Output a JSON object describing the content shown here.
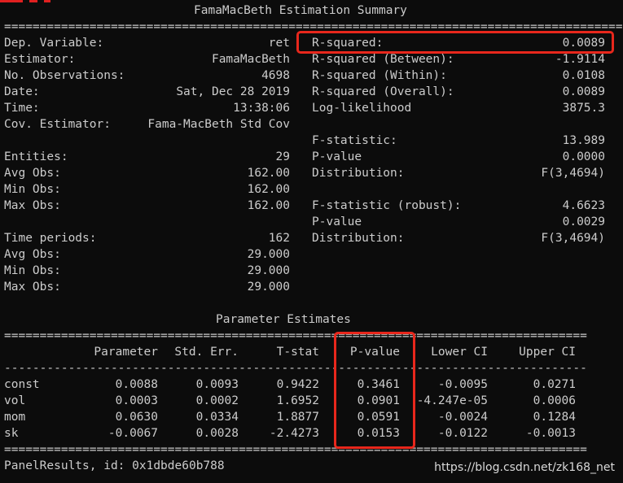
{
  "summary": {
    "title": "FamaMacBeth Estimation Summary",
    "rows": [
      {
        "left_label": "Dep. Variable:",
        "left_value": "ret",
        "right_label": "R-squared:",
        "right_value": "0.0089"
      },
      {
        "left_label": "Estimator:",
        "left_value": "FamaMacBeth",
        "right_label": "R-squared (Between):",
        "right_value": "-1.9114"
      },
      {
        "left_label": "No. Observations:",
        "left_value": "4698",
        "right_label": "R-squared (Within):",
        "right_value": "0.0108"
      },
      {
        "left_label": "Date:",
        "left_value": "Sat, Dec 28 2019",
        "right_label": "R-squared (Overall):",
        "right_value": "0.0089"
      },
      {
        "left_label": "Time:",
        "left_value": "13:38:06",
        "right_label": "Log-likelihood",
        "right_value": "3875.3"
      },
      {
        "left_label": "Cov. Estimator:",
        "left_value": "Fama-MacBeth Std Cov",
        "right_label": "",
        "right_value": ""
      },
      {
        "left_label": "",
        "left_value": "",
        "right_label": "F-statistic:",
        "right_value": "13.989"
      },
      {
        "left_label": "Entities:",
        "left_value": "29",
        "right_label": "P-value",
        "right_value": "0.0000"
      },
      {
        "left_label": "Avg Obs:",
        "left_value": "162.00",
        "right_label": "Distribution:",
        "right_value": "F(3,4694)"
      },
      {
        "left_label": "Min Obs:",
        "left_value": "162.00",
        "right_label": "",
        "right_value": ""
      },
      {
        "left_label": "Max Obs:",
        "left_value": "162.00",
        "right_label": "F-statistic (robust):",
        "right_value": "4.6623"
      },
      {
        "left_label": "",
        "left_value": "",
        "right_label": "P-value",
        "right_value": "0.0029"
      },
      {
        "left_label": "Time periods:",
        "left_value": "162",
        "right_label": "Distribution:",
        "right_value": "F(3,4694)"
      },
      {
        "left_label": "Avg Obs:",
        "left_value": "29.000",
        "right_label": "",
        "right_value": ""
      },
      {
        "left_label": "Min Obs:",
        "left_value": "29.000",
        "right_label": "",
        "right_value": ""
      },
      {
        "left_label": "Max Obs:",
        "left_value": "29.000",
        "right_label": "",
        "right_value": ""
      }
    ]
  },
  "params": {
    "title": "Parameter Estimates",
    "columns": [
      "",
      "Parameter",
      "Std. Err.",
      "T-stat",
      "P-value",
      "Lower CI",
      "Upper CI"
    ],
    "rows": [
      [
        "const",
        "0.0088",
        "0.0093",
        "0.9422",
        "0.3461",
        "-0.0095",
        "0.0271"
      ],
      [
        "vol",
        "0.0003",
        "0.0002",
        "1.6952",
        "0.0901",
        "-4.247e-05",
        "0.0006"
      ],
      [
        "mom",
        "0.0630",
        "0.0334",
        "1.8877",
        "0.0591",
        "-0.0024",
        "0.1284"
      ],
      [
        "sk",
        "-0.0067",
        "0.0028",
        "-2.4273",
        "0.0153",
        "-0.0122",
        "-0.0013"
      ]
    ]
  },
  "footer": "PanelResults, id: 0x1dbde60b788",
  "watermark": "https://blog.csdn.net/zk168_net",
  "colors": {
    "background": "#0c0c0c",
    "text": "#cccccc",
    "highlight": "#e8271c"
  }
}
